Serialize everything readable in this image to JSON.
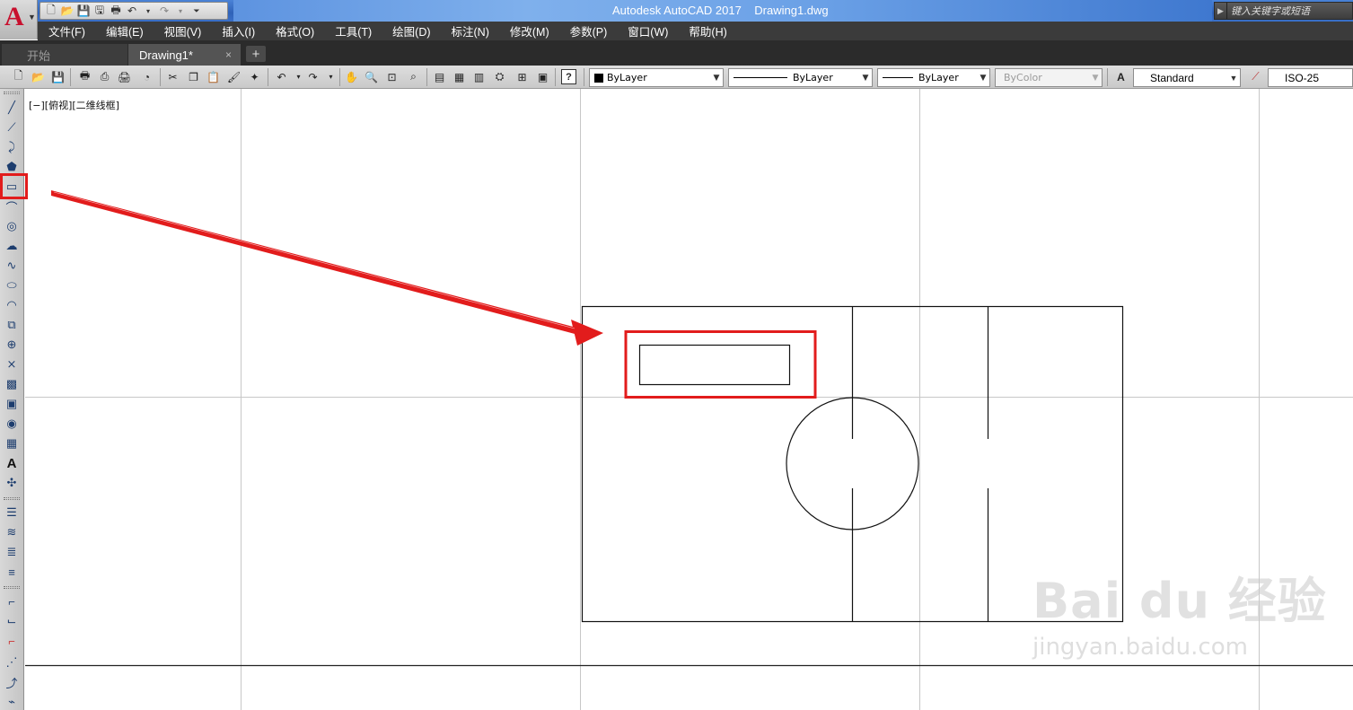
{
  "app": {
    "title": "Autodesk AutoCAD 2017    Drawing1.dwg",
    "logo_letter": "A",
    "search_placeholder": "键入关键字或短语"
  },
  "menu": [
    "文件(F)",
    "编辑(E)",
    "视图(V)",
    "插入(I)",
    "格式(O)",
    "工具(T)",
    "绘图(D)",
    "标注(N)",
    "修改(M)",
    "参数(P)",
    "窗口(W)",
    "帮助(H)"
  ],
  "tabs": {
    "start": "开始",
    "drawing": "Drawing1*",
    "close_glyph": "×",
    "plus_glyph": "+"
  },
  "properties": {
    "color": "ByLayer",
    "linetype": "ByLayer",
    "lineweight": "ByLayer",
    "plotstyle": "ByColor",
    "text_style": "Standard",
    "dim_style": "ISO-25"
  },
  "viewport": {
    "label": "[−][俯视][二维线框]"
  },
  "watermark": {
    "brand": "Bai du 经验",
    "url": "jingyan.baidu.com"
  },
  "colors": {
    "highlight": "#e21c1c",
    "menubar": "#3b3b3b",
    "titlebar": "#2f62b8"
  },
  "left_toolbar_icons": [
    "line-icon",
    "construction-line-icon",
    "polyline-icon",
    "polygon-icon",
    "rectangle-icon",
    "arc-icon",
    "circle-icon",
    "revision-cloud-icon",
    "spline-icon",
    "ellipse-icon",
    "ellipse-arc-icon",
    "insert-block-icon",
    "make-block-icon",
    "point-icon",
    "hatch-icon",
    "gradient-icon",
    "region-icon",
    "table-icon",
    "multiline-text-icon",
    "add-selected-icon"
  ]
}
